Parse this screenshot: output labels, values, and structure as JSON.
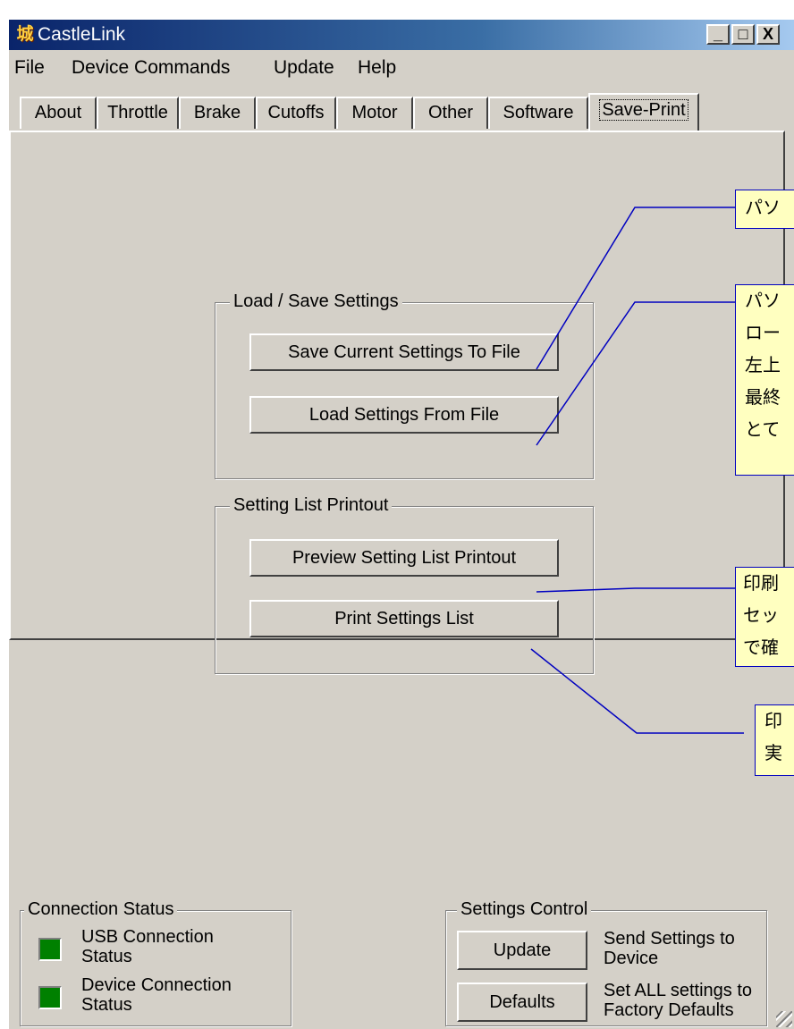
{
  "window": {
    "title": "CastleLink",
    "icon": "castle-app-icon",
    "controls": {
      "minimize": "_",
      "maximize": "□",
      "close": "X"
    }
  },
  "menu": [
    "File",
    "Device Commands",
    "Update",
    "Help"
  ],
  "tabs": [
    "About",
    "Throttle",
    "Brake",
    "Cutoffs",
    "Motor",
    "Other",
    "Software",
    "Save-Print"
  ],
  "active_tab": "Save-Print",
  "load_save": {
    "label": "Load / Save Settings",
    "save_button": "Save Current Settings To File",
    "load_button": "Load Settings From File"
  },
  "printout": {
    "label": "Setting List Printout",
    "preview_button": "Preview Setting List Printout",
    "print_button": "Print Settings List"
  },
  "callouts": [
    [
      "パソ"
    ],
    [
      "パソ",
      "ロー",
      "左上",
      "最終",
      "とて"
    ],
    [
      "印刷",
      "セッ",
      "で確"
    ],
    [
      "印",
      "実"
    ]
  ],
  "connection_status": {
    "label": "Connection Status",
    "usb": [
      "USB Connection",
      "Status"
    ],
    "device": [
      "Device Connection",
      "Status"
    ],
    "led_color": "#008000"
  },
  "settings_control": {
    "label": "Settings Control",
    "update_button": "Update",
    "update_desc": [
      "Send Settings to",
      "Device"
    ],
    "defaults_button": "Defaults",
    "defaults_desc": [
      "Set ALL settings to",
      "Factory Defaults"
    ]
  },
  "colors": {
    "titlebar": "#0a246a",
    "callout_bg": "#ffffc0",
    "callout_line": "#0000c0"
  }
}
